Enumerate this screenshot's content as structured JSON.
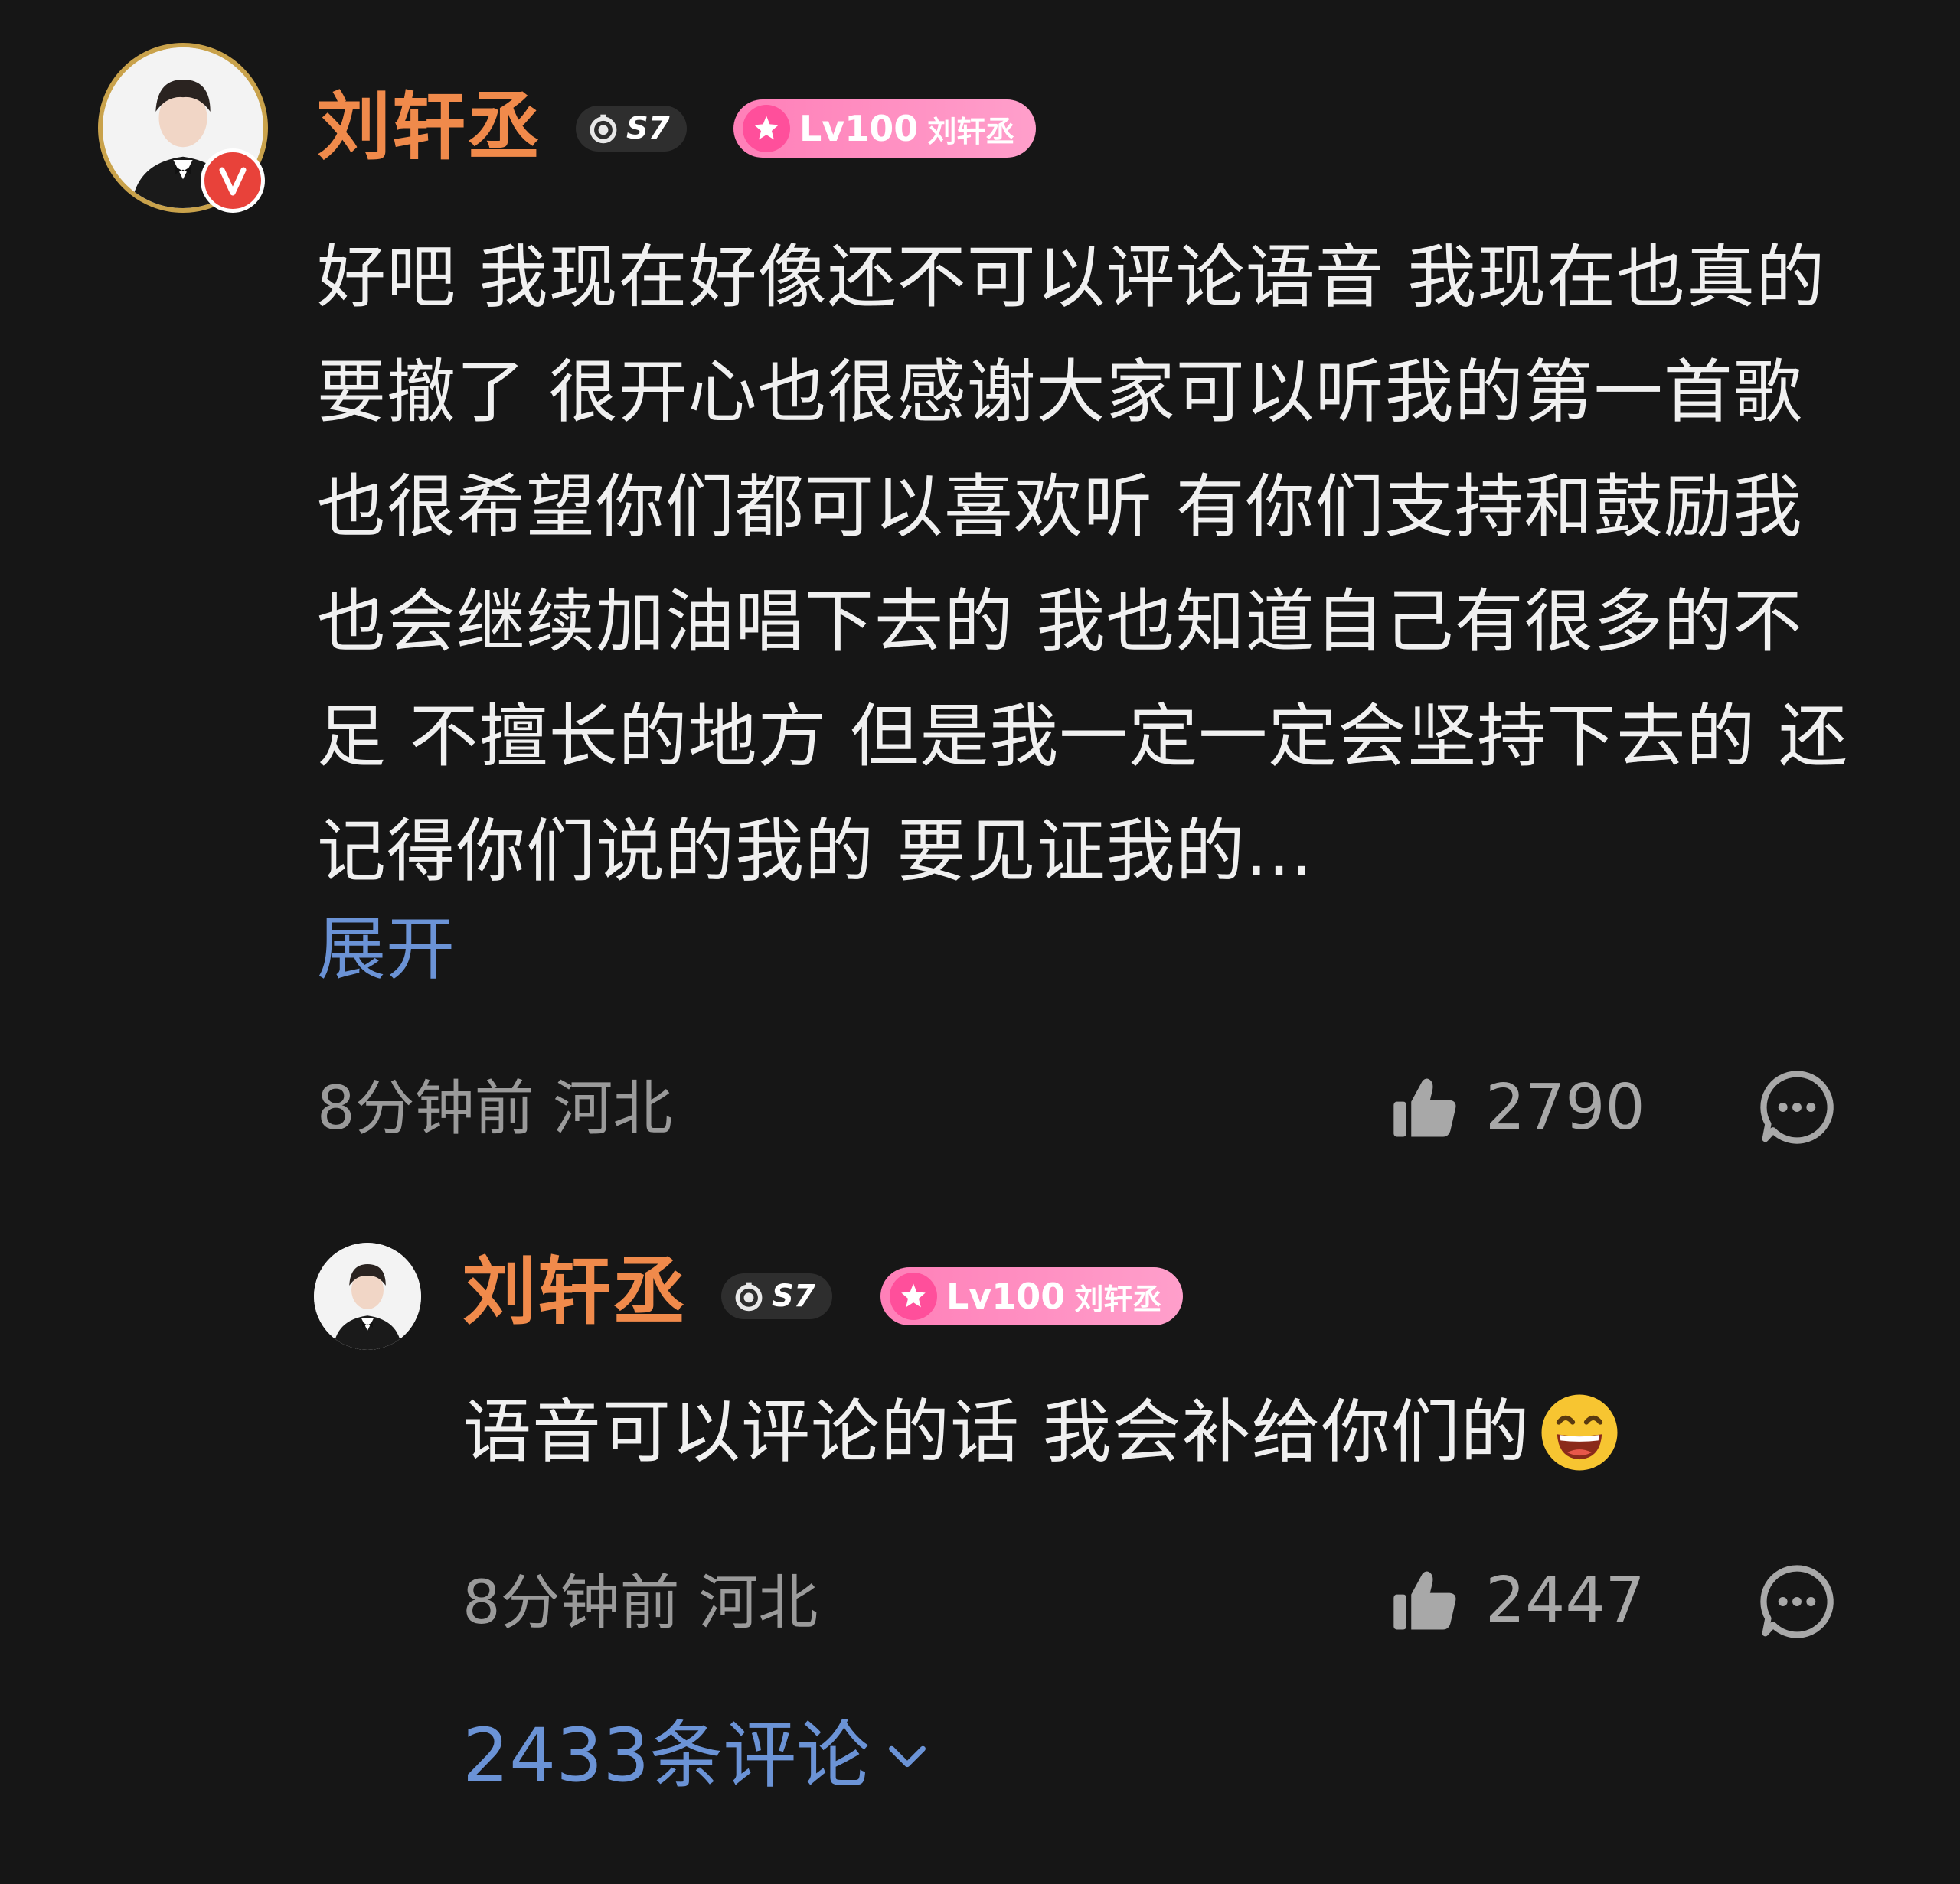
{
  "comment": {
    "username": "刘轩丞",
    "badge_s7": "S7",
    "level": "Lv100",
    "fan_name": "刘轩丞",
    "body": "好吧 我现在好像还不可以评论语音 我现在也真的要撤了 很开心也很感谢大家可以听我的第一首歌 也很希望你们都可以喜欢听 有你们支持和鼓励我也会继续加油唱下去的 我也知道自己有很多的不足 不擅长的地方 但是我一定一定会坚持下去的 还记得你们说的我的 要见证我的...",
    "expand_label": "展开",
    "meta": "8分钟前 河北",
    "likes": "2790"
  },
  "reply": {
    "username": "刘轩丞",
    "badge_s7": "S7",
    "level": "Lv100",
    "fan_name": "刘轩丞",
    "body": "语音可以评论的话 我会补给你们的",
    "meta": "8分钟前 河北",
    "likes": "2447"
  },
  "more_comments_label": "2433条评论",
  "colors": {
    "background": "#161616",
    "username": "#f08a4b",
    "link": "#6b93d6",
    "meta": "#9a9a9a",
    "level_badge": "#ff8fc0"
  },
  "icons": {
    "verified": "verified-v-icon",
    "like": "thumbs-up-icon",
    "reply": "chat-bubble-icon",
    "expand": "chevron-down-icon",
    "emoji": "grinning-face-emoji"
  }
}
